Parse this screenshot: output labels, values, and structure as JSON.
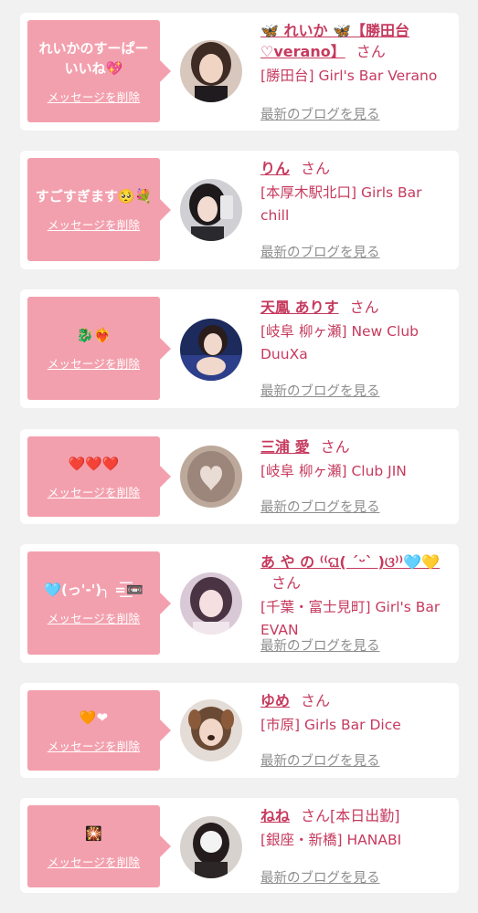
{
  "delete_label": "メッセージを削除",
  "blog_label": "最新のブログを見る",
  "honorific": "さん",
  "colors": {
    "bubble": "#f3a0ae",
    "accent": "#c63a5e",
    "link_gray": "#8e8e8e",
    "card_bg": "#ffffff",
    "page_bg": "#f1f1f1"
  },
  "messages": [
    {
      "message": "れいかのすーぱーいいね💖",
      "name": "🦋 れいか 🦋【勝田台♡verano】",
      "suffix": "",
      "shop": "[勝田台] Girl's Bar Verano",
      "avatar": "avatar-reika"
    },
    {
      "message": "すごすぎます🥺💐",
      "name": "りん",
      "suffix": "",
      "shop": "[本厚木駅北口] Girls Bar chill",
      "avatar": "avatar-rin"
    },
    {
      "message": "🐉❤️‍🔥",
      "name": "天鳳 ありす",
      "suffix": "",
      "shop": "[岐阜 柳ヶ瀬] New Club DuuXa",
      "avatar": "avatar-arisu"
    },
    {
      "message": "❤️❤️❤️",
      "name": "三浦 愛",
      "suffix": "",
      "shop": "[岐阜 柳ヶ瀬] Club JIN",
      "avatar": "avatar-ai"
    },
    {
      "message": "🩵(っ'-')╮ =͟͟͞͞📼",
      "name": "あ や の ⁽⁽ଘ( ˊᵕˋ )ଓ⁾⁾🩵💛",
      "suffix": "",
      "shop": "[千葉・富士見町] Girl's Bar EVAN",
      "avatar": "avatar-ayano"
    },
    {
      "message": "🧡❤",
      "name": "ゆめ",
      "suffix": "",
      "shop": "[市原] Girls Bar Dice",
      "avatar": "avatar-yume"
    },
    {
      "message": "🎇",
      "name": "ねね",
      "suffix": "[本日出勤]",
      "shop": "[銀座・新橋] HANABI",
      "avatar": "avatar-nene"
    }
  ]
}
